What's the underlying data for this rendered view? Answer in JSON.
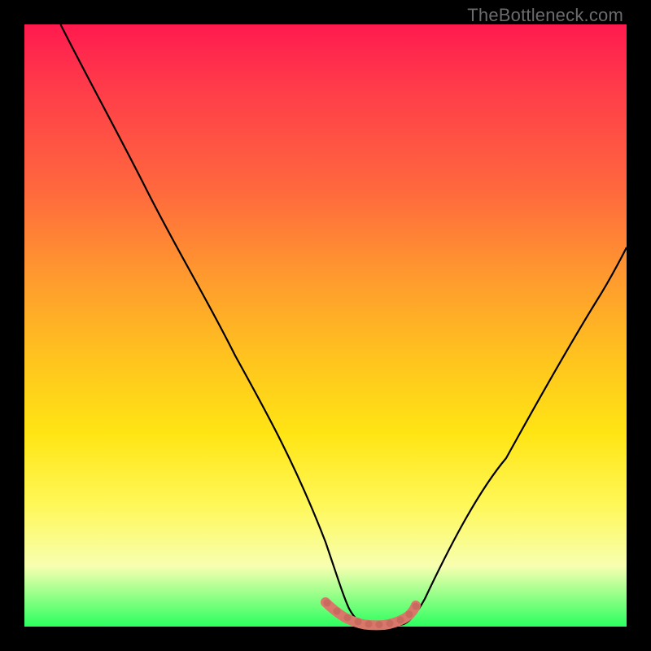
{
  "watermark": "TheBottleneck.com",
  "chart_data": {
    "type": "line",
    "title": "",
    "xlabel": "",
    "ylabel": "",
    "xlim": [
      0,
      100
    ],
    "ylim": [
      0,
      100
    ],
    "grid": false,
    "legend": false,
    "series": [
      {
        "name": "bottleneck-curve",
        "color": "#000000",
        "x": [
          6,
          10,
          15,
          20,
          25,
          30,
          35,
          40,
          45,
          50,
          53,
          55,
          57,
          60,
          63,
          65,
          70,
          75,
          80,
          85,
          90,
          95,
          100
        ],
        "y": [
          100,
          92,
          83,
          73,
          64,
          55,
          46,
          36,
          27,
          14,
          5,
          1,
          0,
          0,
          0,
          1,
          8,
          18,
          28,
          37,
          46,
          55,
          63
        ]
      },
      {
        "name": "valley-highlight",
        "color": "#d9776b",
        "x": [
          50,
          51,
          52,
          53,
          54,
          55,
          56,
          57,
          58,
          59,
          60,
          61,
          62,
          63,
          64,
          65
        ],
        "y": [
          4.0,
          3.0,
          2.2,
          1.5,
          1.0,
          0.6,
          0.3,
          0.2,
          0.2,
          0.3,
          0.5,
          0.8,
          1.3,
          1.9,
          2.6,
          3.5
        ]
      }
    ],
    "background_gradient_stops": [
      {
        "pos": 0.0,
        "color": "#ff1a4f"
      },
      {
        "pos": 0.28,
        "color": "#ff6a3d"
      },
      {
        "pos": 0.55,
        "color": "#ffc21f"
      },
      {
        "pos": 0.8,
        "color": "#fff85a"
      },
      {
        "pos": 1.0,
        "color": "#2bff5e"
      }
    ]
  }
}
